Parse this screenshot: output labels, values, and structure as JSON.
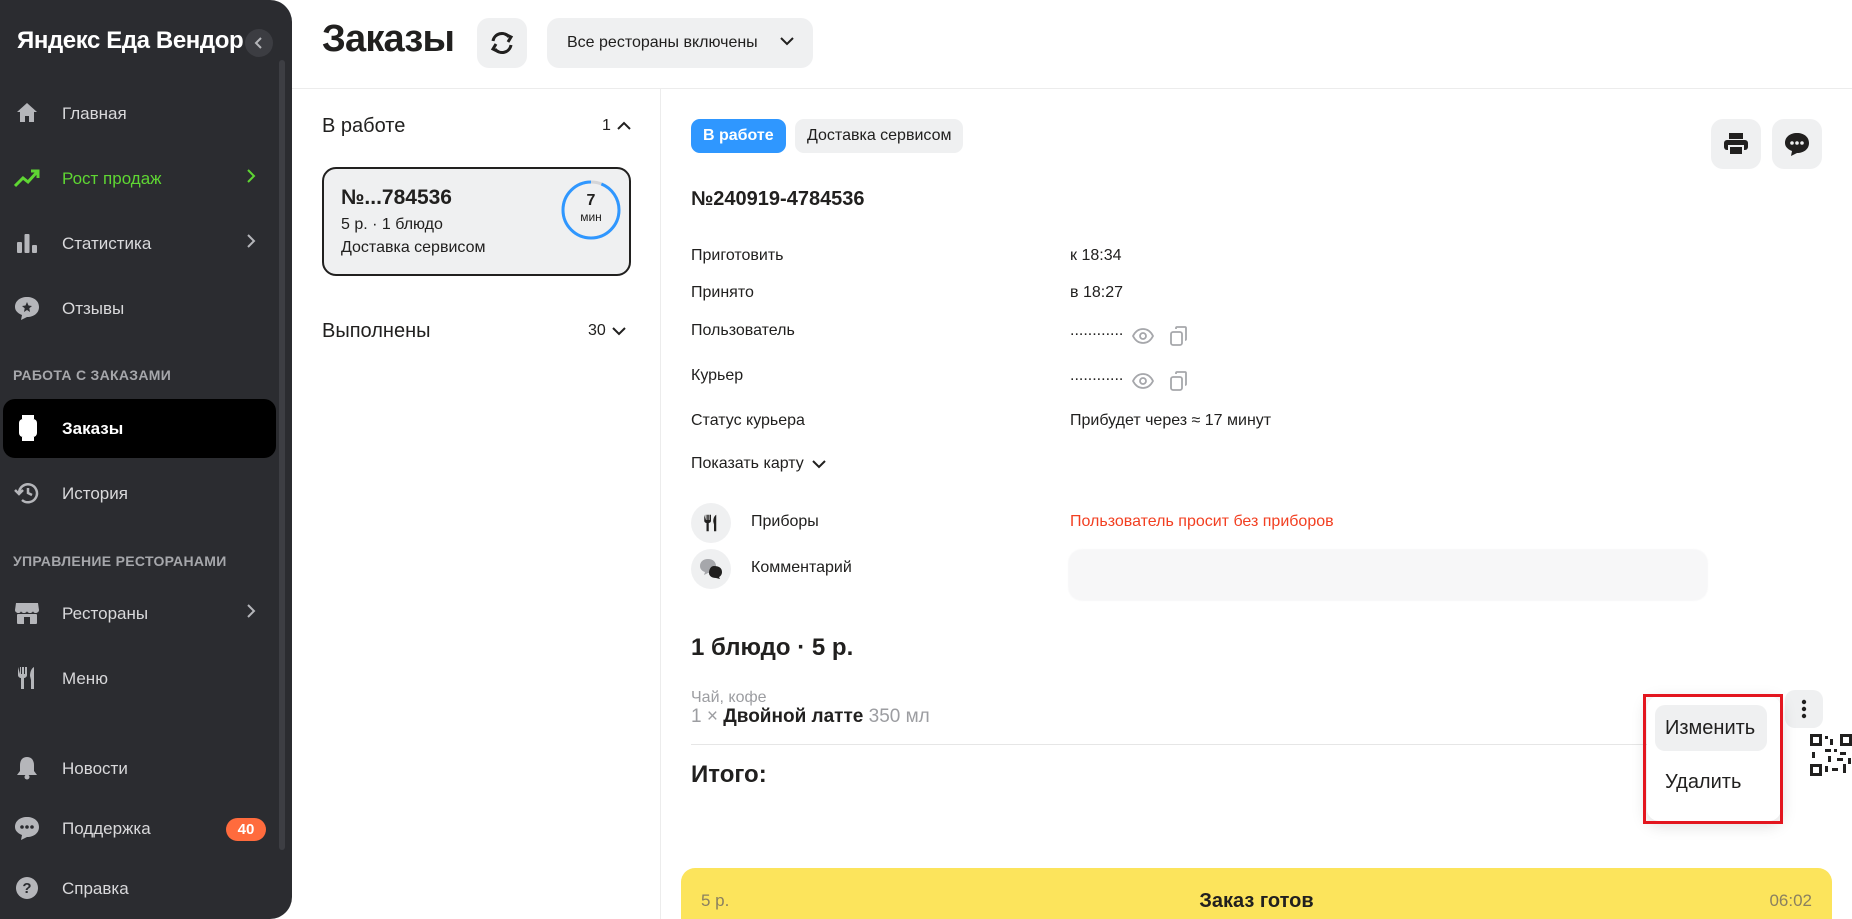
{
  "sidebar": {
    "brand": "Яндекс Еда Вендор",
    "items": [
      {
        "label": "Главная"
      },
      {
        "label": "Рост продаж"
      },
      {
        "label": "Статистика"
      },
      {
        "label": "Отзывы"
      },
      {
        "label": "Заказы"
      },
      {
        "label": "История"
      },
      {
        "label": "Рестораны"
      },
      {
        "label": "Меню"
      },
      {
        "label": "Новости"
      },
      {
        "label": "Поддержка",
        "badge": "40"
      },
      {
        "label": "Справка"
      }
    ],
    "sections": {
      "orders": "РАБОТА С ЗАКАЗАМИ",
      "restaurants": "УПРАВЛЕНИЕ РЕСТОРАНАМИ"
    },
    "accent_green": "#5fd633"
  },
  "header": {
    "title": "Заказы",
    "restaurants_select": "Все рестораны включены"
  },
  "orders_list": {
    "in_progress": {
      "title": "В работе",
      "count": "1"
    },
    "completed": {
      "title": "Выполнены",
      "count": "30"
    },
    "card": {
      "number": "№...784536",
      "summary": "5 р. · 1 блюдо",
      "delivery": "Доставка сервисом",
      "timer_value": "7",
      "timer_unit": "мин"
    }
  },
  "detail": {
    "status_pill": "В работе",
    "delivery_pill": "Доставка сервисом",
    "order_number": "№240919-4784536",
    "fields": [
      {
        "key": "Приготовить",
        "value": "к 18:34"
      },
      {
        "key": "Принято",
        "value": "в 18:27"
      },
      {
        "key": "Пользователь",
        "value": "............"
      },
      {
        "key": "Курьер",
        "value": "............"
      },
      {
        "key": "Статус курьера",
        "value": "Прибудет через ≈ 17 минут"
      }
    ],
    "show_map": "Показать карту",
    "cutlery_label": "Приборы",
    "cutlery_value": "Пользователь просит без приборов",
    "comment_label": "Комментарий",
    "dishes_title": "1 блюдо · 5 р.",
    "dish_category": "Чай, кофе",
    "dish_qty": "1 ×",
    "dish_name": "Двойной латте",
    "dish_volume": "350 мл",
    "total_label": "Итого:"
  },
  "context_menu": {
    "edit": "Изменить",
    "delete": "Удалить"
  },
  "ready_bar": {
    "price": "5 р.",
    "label": "Заказ готов",
    "time": "06:02"
  }
}
